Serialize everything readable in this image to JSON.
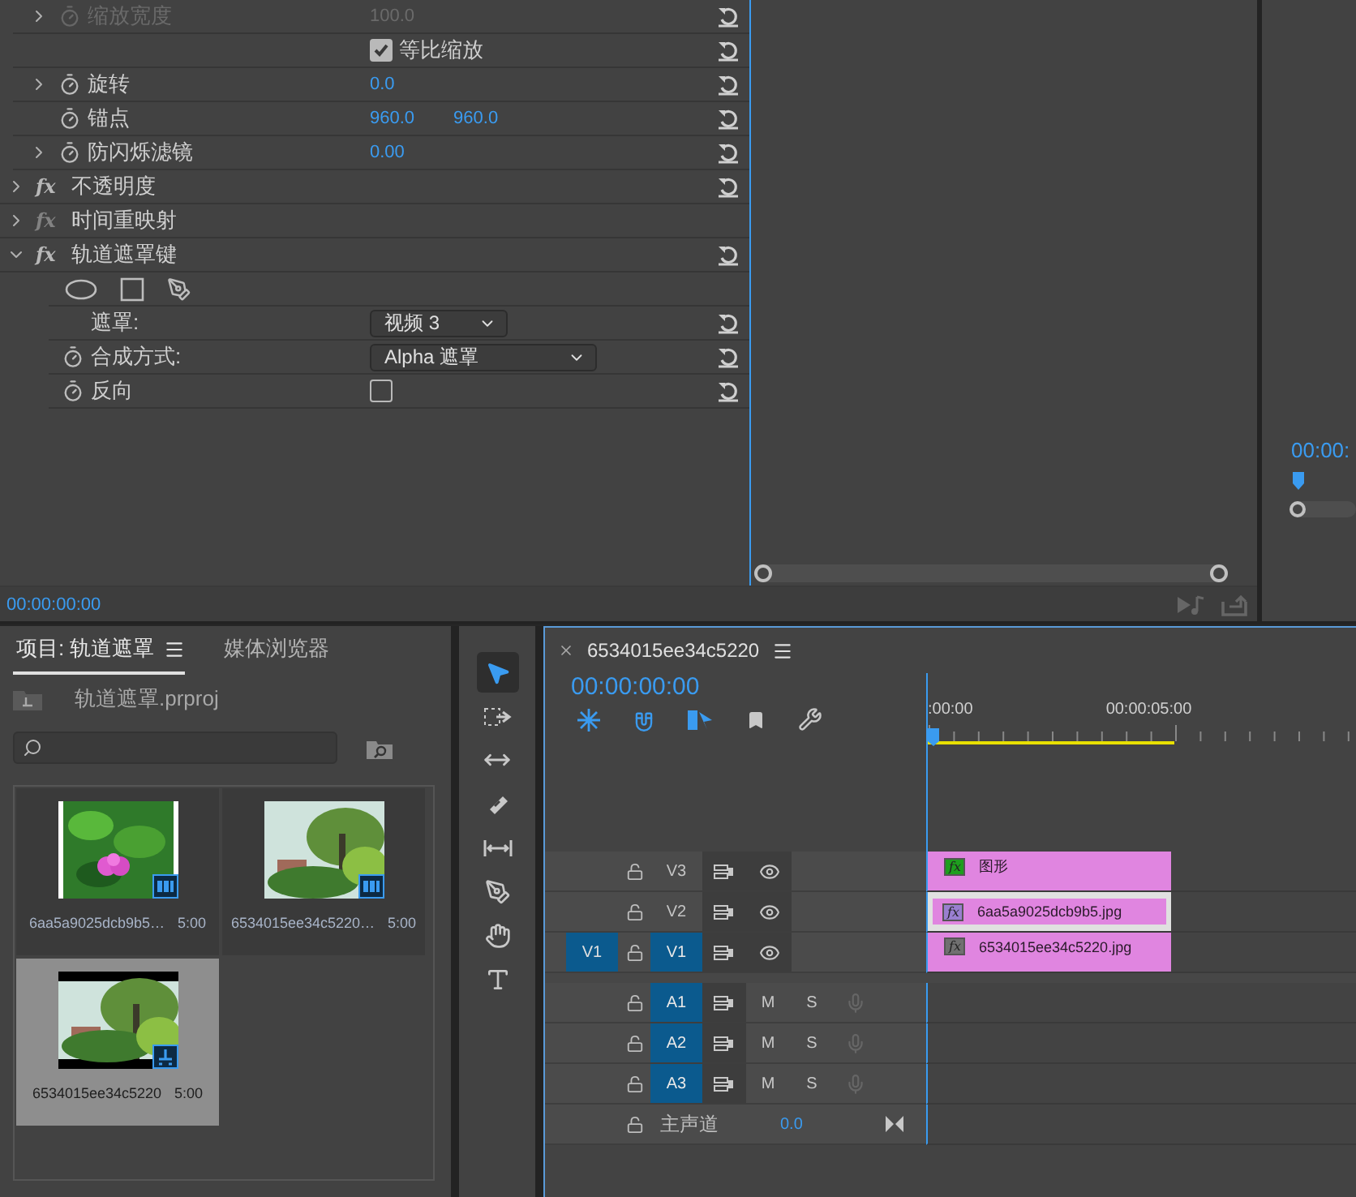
{
  "effect_controls": {
    "rows": [
      {
        "kind": "param",
        "label": "缩放宽度",
        "values": [
          "100.0"
        ],
        "expandable": true,
        "disabled": true,
        "reset": true
      },
      {
        "kind": "checkbox",
        "label": "等比缩放",
        "checked": true,
        "reset": true
      },
      {
        "kind": "param",
        "label": "旋转",
        "values": [
          "0.0"
        ],
        "expandable": true,
        "disabled": false,
        "reset": true
      },
      {
        "kind": "param",
        "label": "锚点",
        "values": [
          "960.0",
          "960.0"
        ],
        "expandable": false,
        "disabled": false,
        "reset": true
      },
      {
        "kind": "param",
        "label": "防闪烁滤镜",
        "values": [
          "0.00"
        ],
        "expandable": true,
        "disabled": false,
        "reset": true
      },
      {
        "kind": "effect",
        "badge": "fx",
        "label": "不透明度",
        "expanded": false,
        "enabled": true,
        "reset": true
      },
      {
        "kind": "effect",
        "badge": "fx",
        "label": "时间重映射",
        "expanded": false,
        "enabled": false,
        "reset": false
      },
      {
        "kind": "effect",
        "badge": "fx",
        "label": "轨道遮罩键",
        "expanded": true,
        "enabled": true,
        "reset": true
      },
      {
        "kind": "shapes",
        "reset": false
      },
      {
        "kind": "dropdown",
        "label": "遮罩:",
        "value": "视频 3",
        "stopwatch": false,
        "wide": false,
        "reset": true
      },
      {
        "kind": "dropdown",
        "label": "合成方式:",
        "value": "Alpha 遮罩",
        "stopwatch": true,
        "wide": true,
        "reset": true
      },
      {
        "kind": "toggle",
        "label": "反向",
        "checked": false,
        "reset": true
      }
    ],
    "timecode": "00:00:00:00"
  },
  "program_monitor": {
    "timecode": "00:00:"
  },
  "project": {
    "tabs": [
      {
        "label": "项目: 轨道遮罩",
        "selected": true,
        "menu": true
      },
      {
        "label": "媒体浏览器",
        "selected": false,
        "menu": false
      }
    ],
    "file": "轨道遮罩.prproj",
    "items": [
      {
        "name": "6aa5a9025dcb9b5…",
        "duration": "5:00",
        "kind": "clip",
        "selected": false
      },
      {
        "name": "6534015ee34c5220…",
        "duration": "5:00",
        "kind": "clip",
        "selected": false
      },
      {
        "name": "6534015ee34c5220",
        "duration": "5:00",
        "kind": "sequence",
        "selected": true
      }
    ]
  },
  "tools": [
    {
      "kind": "select",
      "selected": true
    },
    {
      "kind": "track_select",
      "selected": false
    },
    {
      "kind": "ripple",
      "selected": false
    },
    {
      "kind": "razor",
      "selected": false
    },
    {
      "kind": "slip",
      "selected": false
    },
    {
      "kind": "pen",
      "selected": false
    },
    {
      "kind": "hand",
      "selected": false
    },
    {
      "kind": "type",
      "selected": false
    }
  ],
  "timeline": {
    "tab": "6534015ee34c5220",
    "timecode": "00:00:00:00",
    "ruler": [
      ":00:00",
      "00:00:05:00"
    ],
    "video_tracks": [
      {
        "label": "V3",
        "targeted": false,
        "clip": {
          "name": "图形",
          "badge": "fx",
          "color": "#1e9e1e",
          "selected": false
        }
      },
      {
        "label": "V2",
        "targeted": false,
        "clip": {
          "name": "6aa5a9025dcb9b5.jpg",
          "badge": "fx",
          "color": "#9a7fd0",
          "selected": true
        }
      },
      {
        "label": "V1",
        "targeted": true,
        "source": "V1",
        "clip": {
          "name": "6534015ee34c5220.jpg",
          "badge": "fx",
          "color": "#707070",
          "selected": false
        }
      }
    ],
    "audio_tracks": [
      {
        "label": "A1",
        "targeted": true,
        "mute": "M",
        "solo": "S"
      },
      {
        "label": "A2",
        "targeted": true,
        "mute": "M",
        "solo": "S"
      },
      {
        "label": "A3",
        "targeted": true,
        "mute": "M",
        "solo": "S"
      }
    ],
    "master": {
      "label": "主声道",
      "value": "0.0"
    }
  }
}
